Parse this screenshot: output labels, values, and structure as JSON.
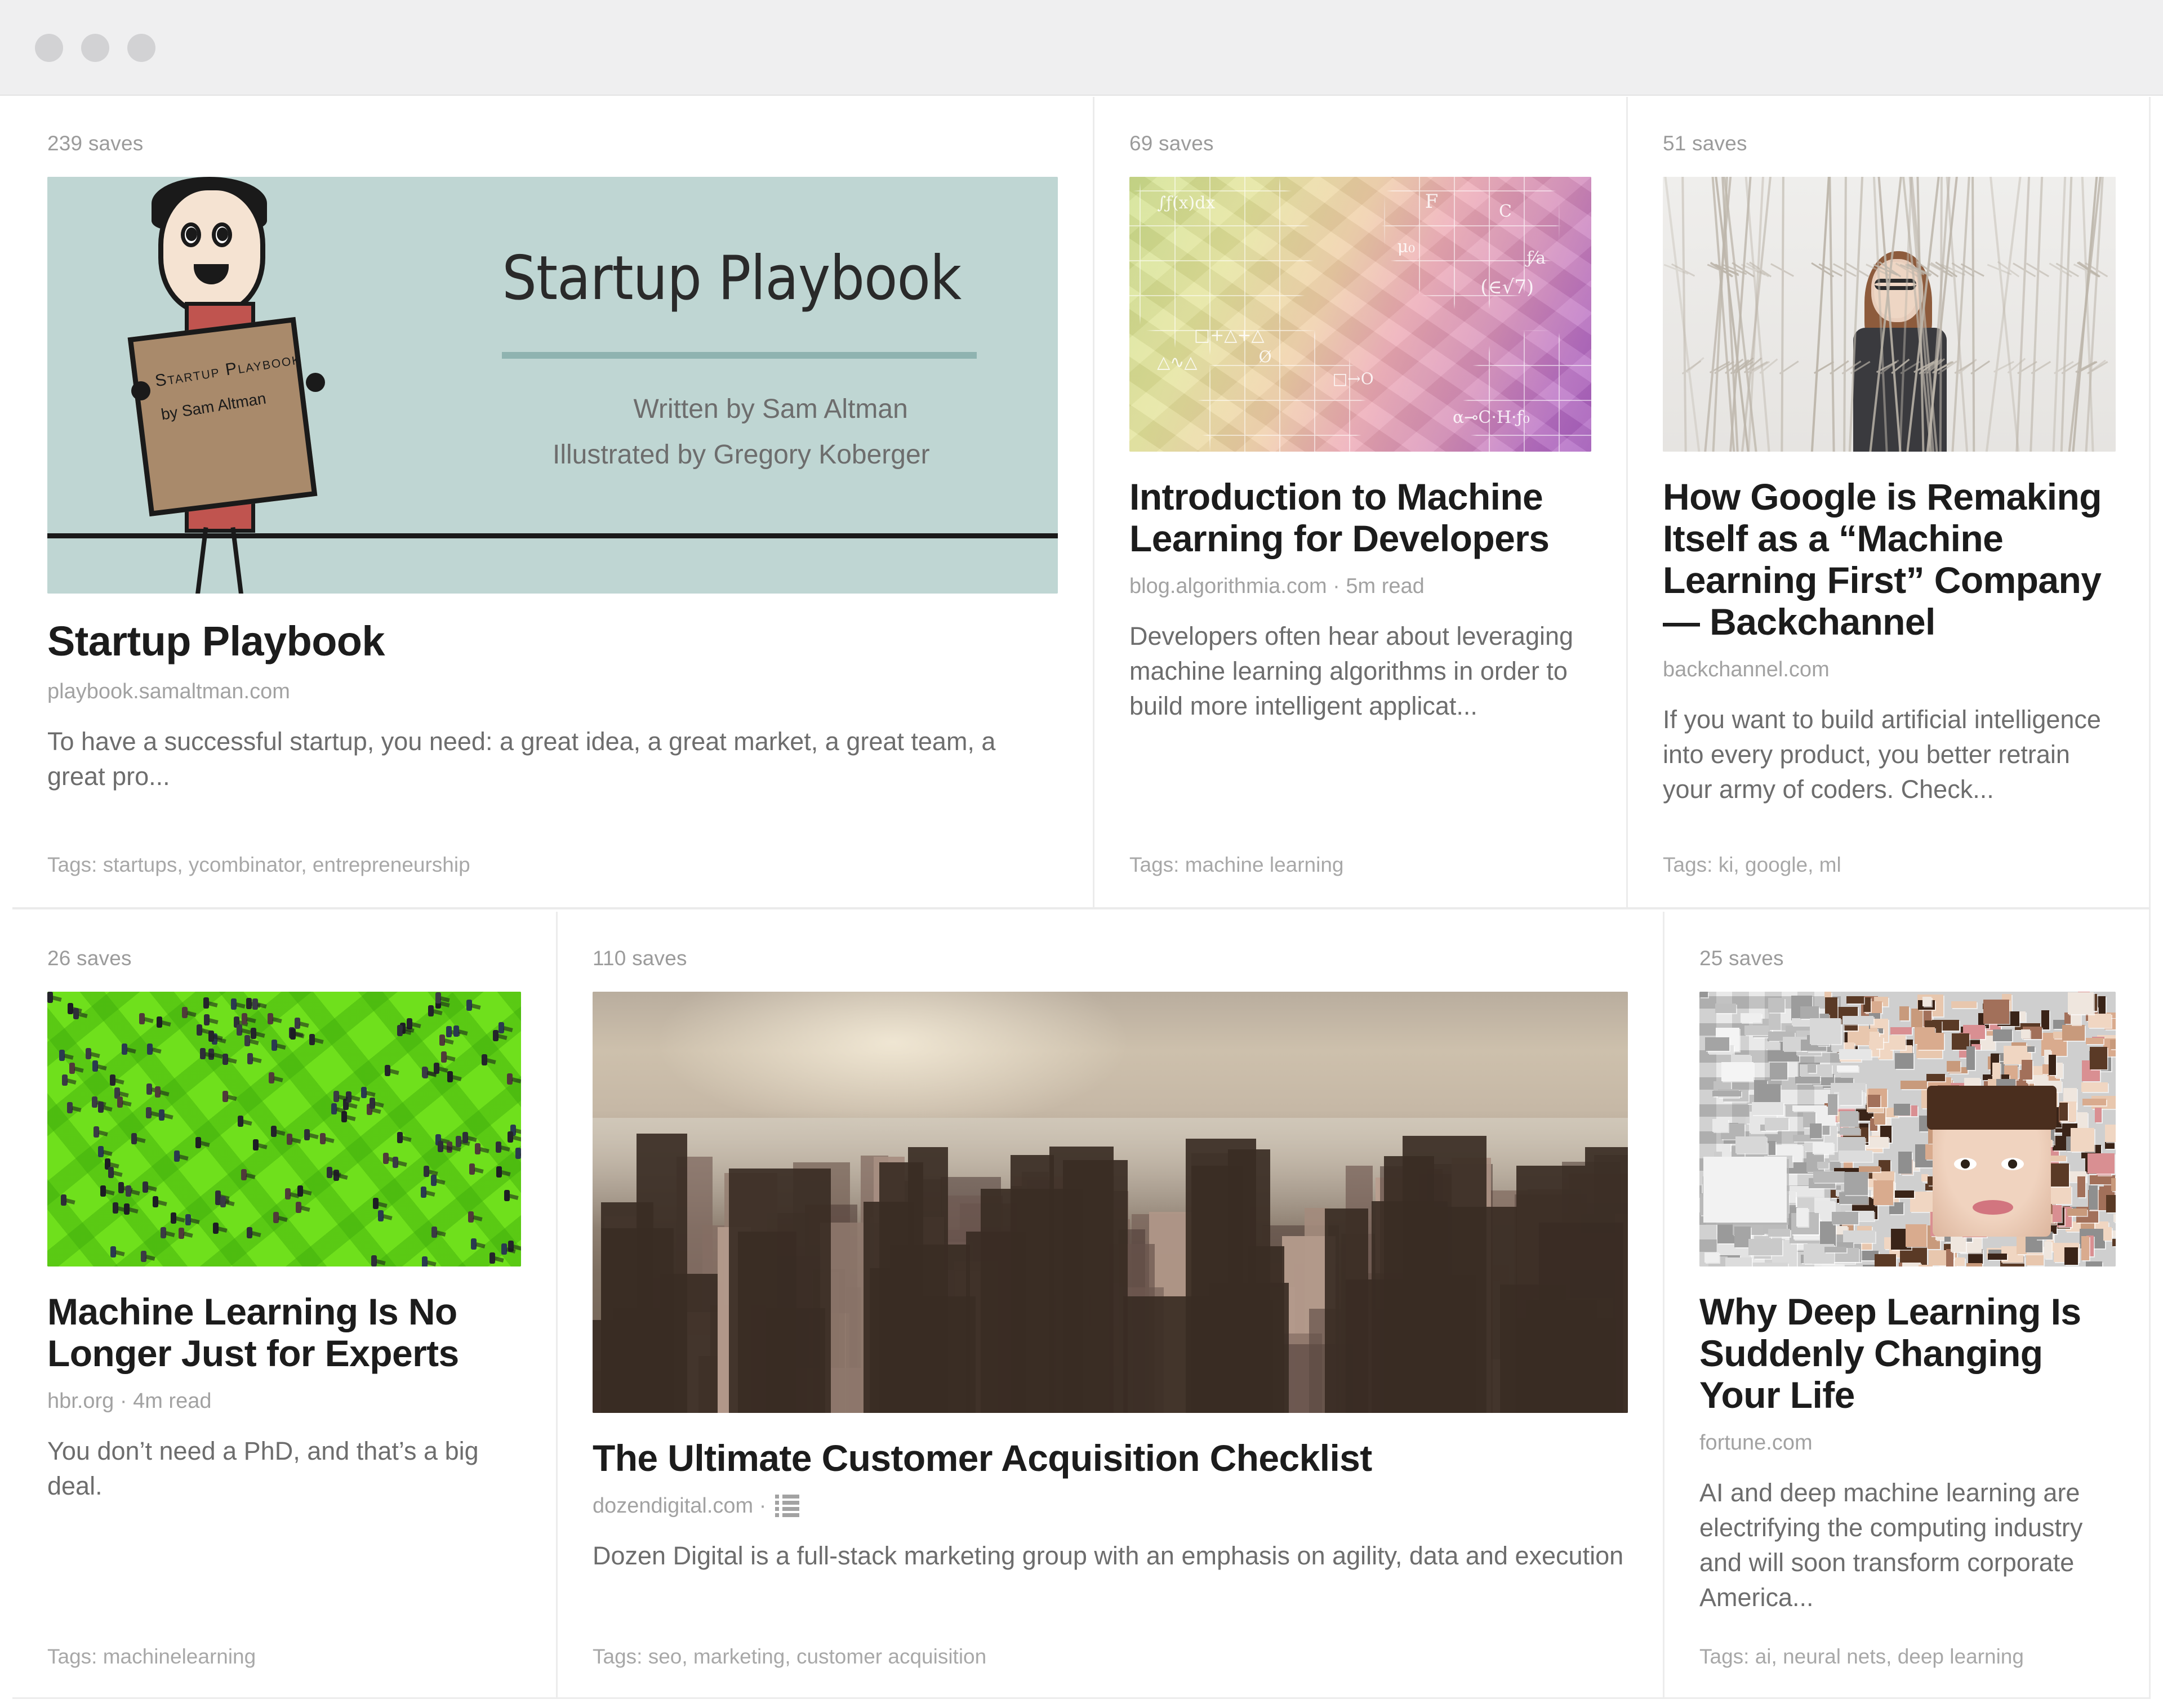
{
  "window": {
    "traffic_lights": [
      "close",
      "minimize",
      "maximize"
    ]
  },
  "cards": [
    {
      "id": "startup-playbook",
      "saves": "239 saves",
      "title": "Startup Playbook",
      "source": "playbook.samaltman.com",
      "read_time": "",
      "meta": "playbook.samaltman.com",
      "excerpt": "To have a successful startup, you need: a great idea, a great market, a great team, a great pro...",
      "tags": "Tags: startups, ycombinator, entrepreneurship",
      "thumbnail": "startup-playbook-illustration",
      "thumbnail_text": {
        "title": "Startup Playbook",
        "written_by": "Written by Sam Altman",
        "illustrated_by": "Illustrated by Gregory Koberger",
        "sign_line1": "Startup Playbook",
        "sign_line2": "by Sam Altman"
      }
    },
    {
      "id": "intro-machine-learning",
      "saves": "69 saves",
      "title": "Introduction to Machine Learning for Developers",
      "source": "blog.algorithmia.com",
      "read_time": "5m read",
      "meta": "blog.algorithmia.com · 5m read",
      "excerpt": "Developers often hear about leveraging machine learning algorithms in order to build more intelligent applicat...",
      "tags": "Tags: machine learning",
      "thumbnail": "math-formulas-gradient"
    },
    {
      "id": "google-machine-learning-first",
      "saves": "51 saves",
      "title": "How Google is Remaking Itself as a “Machine Learning First” Company — Backchannel",
      "source": "backchannel.com",
      "read_time": "",
      "meta": "backchannel.com",
      "excerpt": "If you want to build artificial intelligence into every product, you better retrain your army of coders. Check...",
      "tags": "Tags: ki, google, ml",
      "thumbnail": "woman-behind-branches-photo"
    },
    {
      "id": "ml-no-longer-experts",
      "saves": "26 saves",
      "title": "Machine Learning Is No Longer Just for Experts",
      "source": "hbr.org",
      "read_time": "4m read",
      "meta": "hbr.org · 4m read",
      "excerpt": "You don’t need a PhD, and that’s a big deal.",
      "tags": "Tags: machinelearning",
      "thumbnail": "green-maze-crowd-photo"
    },
    {
      "id": "customer-acquisition-checklist",
      "saves": "110 saves",
      "title": "The Ultimate Customer Acquisition Checklist",
      "source": "dozendigital.com",
      "read_time": "",
      "meta": "dozendigital.com ·",
      "meta_icon": "list-icon",
      "excerpt": "Dozen Digital is a full-stack marketing group with an emphasis on agility, data and execution",
      "tags": "Tags: seo, marketing, customer acquisition",
      "thumbnail": "city-skyline-photo"
    },
    {
      "id": "deep-learning-changing-life",
      "saves": "25 saves",
      "title": "Why Deep Learning Is Suddenly Changing Your Life",
      "source": "fortune.com",
      "read_time": "",
      "meta": "fortune.com",
      "excerpt": "AI and deep machine learning are electrifying the computing industry and will soon transform corporate America...",
      "tags": "Tags: ai, neural nets, deep learning",
      "thumbnail": "face-mosaic-photo"
    }
  ],
  "colors": {
    "page_background": "#ffffff",
    "titlebar": "#efeff0",
    "traffic_light": "#d2d2d4",
    "divider": "#ececec",
    "title_text": "#1c1c1c",
    "meta_text": "#a2a2a2",
    "excerpt_text": "#6d6d6d",
    "saves_text": "#9b9b9b",
    "tags_text": "#a8a8a8",
    "playbook_bg": "#bfd6d3",
    "playbook_shirt": "#c0544f",
    "playbook_sign": "#a98a6b",
    "maze_green": "#6fe01c"
  }
}
